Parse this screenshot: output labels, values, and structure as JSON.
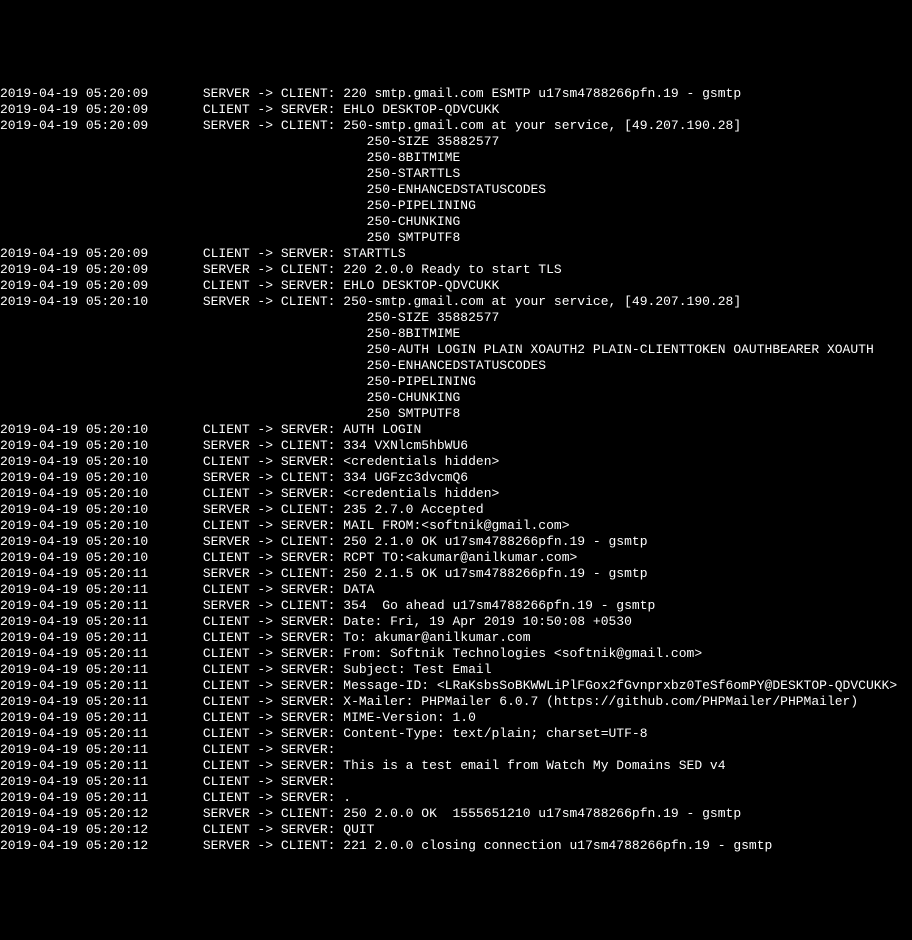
{
  "padding_before_direction": "       ",
  "continuation_prefix": "                                               ",
  "lines": [
    {
      "ts": "2019-04-19 05:20:09",
      "dir": "SERVER -> CLIENT: ",
      "msg": "220 smtp.gmail.com ESMTP u17sm4788266pfn.19 - gsmtp"
    },
    {
      "ts": "2019-04-19 05:20:09",
      "dir": "CLIENT -> SERVER: ",
      "msg": "EHLO DESKTOP-QDVCUKK"
    },
    {
      "ts": "2019-04-19 05:20:09",
      "dir": "SERVER -> CLIENT: ",
      "msg": "250-smtp.gmail.com at your service, [49.207.190.28]",
      "cont": [
        "250-SIZE 35882577",
        "250-8BITMIME",
        "250-STARTTLS",
        "250-ENHANCEDSTATUSCODES",
        "250-PIPELINING",
        "250-CHUNKING",
        "250 SMTPUTF8"
      ]
    },
    {
      "ts": "2019-04-19 05:20:09",
      "dir": "CLIENT -> SERVER: ",
      "msg": "STARTTLS"
    },
    {
      "ts": "2019-04-19 05:20:09",
      "dir": "SERVER -> CLIENT: ",
      "msg": "220 2.0.0 Ready to start TLS"
    },
    {
      "ts": "2019-04-19 05:20:09",
      "dir": "CLIENT -> SERVER: ",
      "msg": "EHLO DESKTOP-QDVCUKK"
    },
    {
      "ts": "2019-04-19 05:20:10",
      "dir": "SERVER -> CLIENT: ",
      "msg": "250-smtp.gmail.com at your service, [49.207.190.28]",
      "cont": [
        "250-SIZE 35882577",
        "250-8BITMIME",
        "250-AUTH LOGIN PLAIN XOAUTH2 PLAIN-CLIENTTOKEN OAUTHBEARER XOAUTH",
        "250-ENHANCEDSTATUSCODES",
        "250-PIPELINING",
        "250-CHUNKING",
        "250 SMTPUTF8"
      ]
    },
    {
      "ts": "2019-04-19 05:20:10",
      "dir": "CLIENT -> SERVER: ",
      "msg": "AUTH LOGIN"
    },
    {
      "ts": "2019-04-19 05:20:10",
      "dir": "SERVER -> CLIENT: ",
      "msg": "334 VXNlcm5hbWU6"
    },
    {
      "ts": "2019-04-19 05:20:10",
      "dir": "CLIENT -> SERVER: ",
      "msg": "<credentials hidden>"
    },
    {
      "ts": "2019-04-19 05:20:10",
      "dir": "SERVER -> CLIENT: ",
      "msg": "334 UGFzc3dvcmQ6"
    },
    {
      "ts": "2019-04-19 05:20:10",
      "dir": "CLIENT -> SERVER: ",
      "msg": "<credentials hidden>"
    },
    {
      "ts": "2019-04-19 05:20:10",
      "dir": "SERVER -> CLIENT: ",
      "msg": "235 2.7.0 Accepted"
    },
    {
      "ts": "2019-04-19 05:20:10",
      "dir": "CLIENT -> SERVER: ",
      "msg": "MAIL FROM:<softnik@gmail.com>"
    },
    {
      "ts": "2019-04-19 05:20:10",
      "dir": "SERVER -> CLIENT: ",
      "msg": "250 2.1.0 OK u17sm4788266pfn.19 - gsmtp"
    },
    {
      "ts": "2019-04-19 05:20:10",
      "dir": "CLIENT -> SERVER: ",
      "msg": "RCPT TO:<akumar@anilkumar.com>"
    },
    {
      "ts": "2019-04-19 05:20:11",
      "dir": "SERVER -> CLIENT: ",
      "msg": "250 2.1.5 OK u17sm4788266pfn.19 - gsmtp"
    },
    {
      "ts": "2019-04-19 05:20:11",
      "dir": "CLIENT -> SERVER: ",
      "msg": "DATA"
    },
    {
      "ts": "2019-04-19 05:20:11",
      "dir": "SERVER -> CLIENT: ",
      "msg": "354  Go ahead u17sm4788266pfn.19 - gsmtp"
    },
    {
      "ts": "2019-04-19 05:20:11",
      "dir": "CLIENT -> SERVER: ",
      "msg": "Date: Fri, 19 Apr 2019 10:50:08 +0530"
    },
    {
      "ts": "2019-04-19 05:20:11",
      "dir": "CLIENT -> SERVER: ",
      "msg": "To: akumar@anilkumar.com"
    },
    {
      "ts": "2019-04-19 05:20:11",
      "dir": "CLIENT -> SERVER: ",
      "msg": "From: Softnik Technologies <softnik@gmail.com>"
    },
    {
      "ts": "2019-04-19 05:20:11",
      "dir": "CLIENT -> SERVER: ",
      "msg": "Subject: Test Email"
    },
    {
      "ts": "2019-04-19 05:20:11",
      "dir": "CLIENT -> SERVER: ",
      "msg": "Message-ID: <LRaKsbsSoBKWWLiPlFGox2fGvnprxbz0TeSf6omPY@DESKTOP-QDVCUKK>"
    },
    {
      "ts": "2019-04-19 05:20:11",
      "dir": "CLIENT -> SERVER: ",
      "msg": "X-Mailer: PHPMailer 6.0.7 (https://github.com/PHPMailer/PHPMailer)"
    },
    {
      "ts": "2019-04-19 05:20:11",
      "dir": "CLIENT -> SERVER: ",
      "msg": "MIME-Version: 1.0"
    },
    {
      "ts": "2019-04-19 05:20:11",
      "dir": "CLIENT -> SERVER: ",
      "msg": "Content-Type: text/plain; charset=UTF-8"
    },
    {
      "ts": "2019-04-19 05:20:11",
      "dir": "CLIENT -> SERVER: ",
      "msg": ""
    },
    {
      "ts": "2019-04-19 05:20:11",
      "dir": "CLIENT -> SERVER: ",
      "msg": "This is a test email from Watch My Domains SED v4"
    },
    {
      "ts": "2019-04-19 05:20:11",
      "dir": "CLIENT -> SERVER: ",
      "msg": ""
    },
    {
      "ts": "2019-04-19 05:20:11",
      "dir": "CLIENT -> SERVER: ",
      "msg": "."
    },
    {
      "ts": "2019-04-19 05:20:12",
      "dir": "SERVER -> CLIENT: ",
      "msg": "250 2.0.0 OK  1555651210 u17sm4788266pfn.19 - gsmtp"
    },
    {
      "ts": "2019-04-19 05:20:12",
      "dir": "CLIENT -> SERVER: ",
      "msg": "QUIT"
    },
    {
      "ts": "2019-04-19 05:20:12",
      "dir": "SERVER -> CLIENT: ",
      "msg": "221 2.0.0 closing connection u17sm4788266pfn.19 - gsmtp"
    }
  ]
}
